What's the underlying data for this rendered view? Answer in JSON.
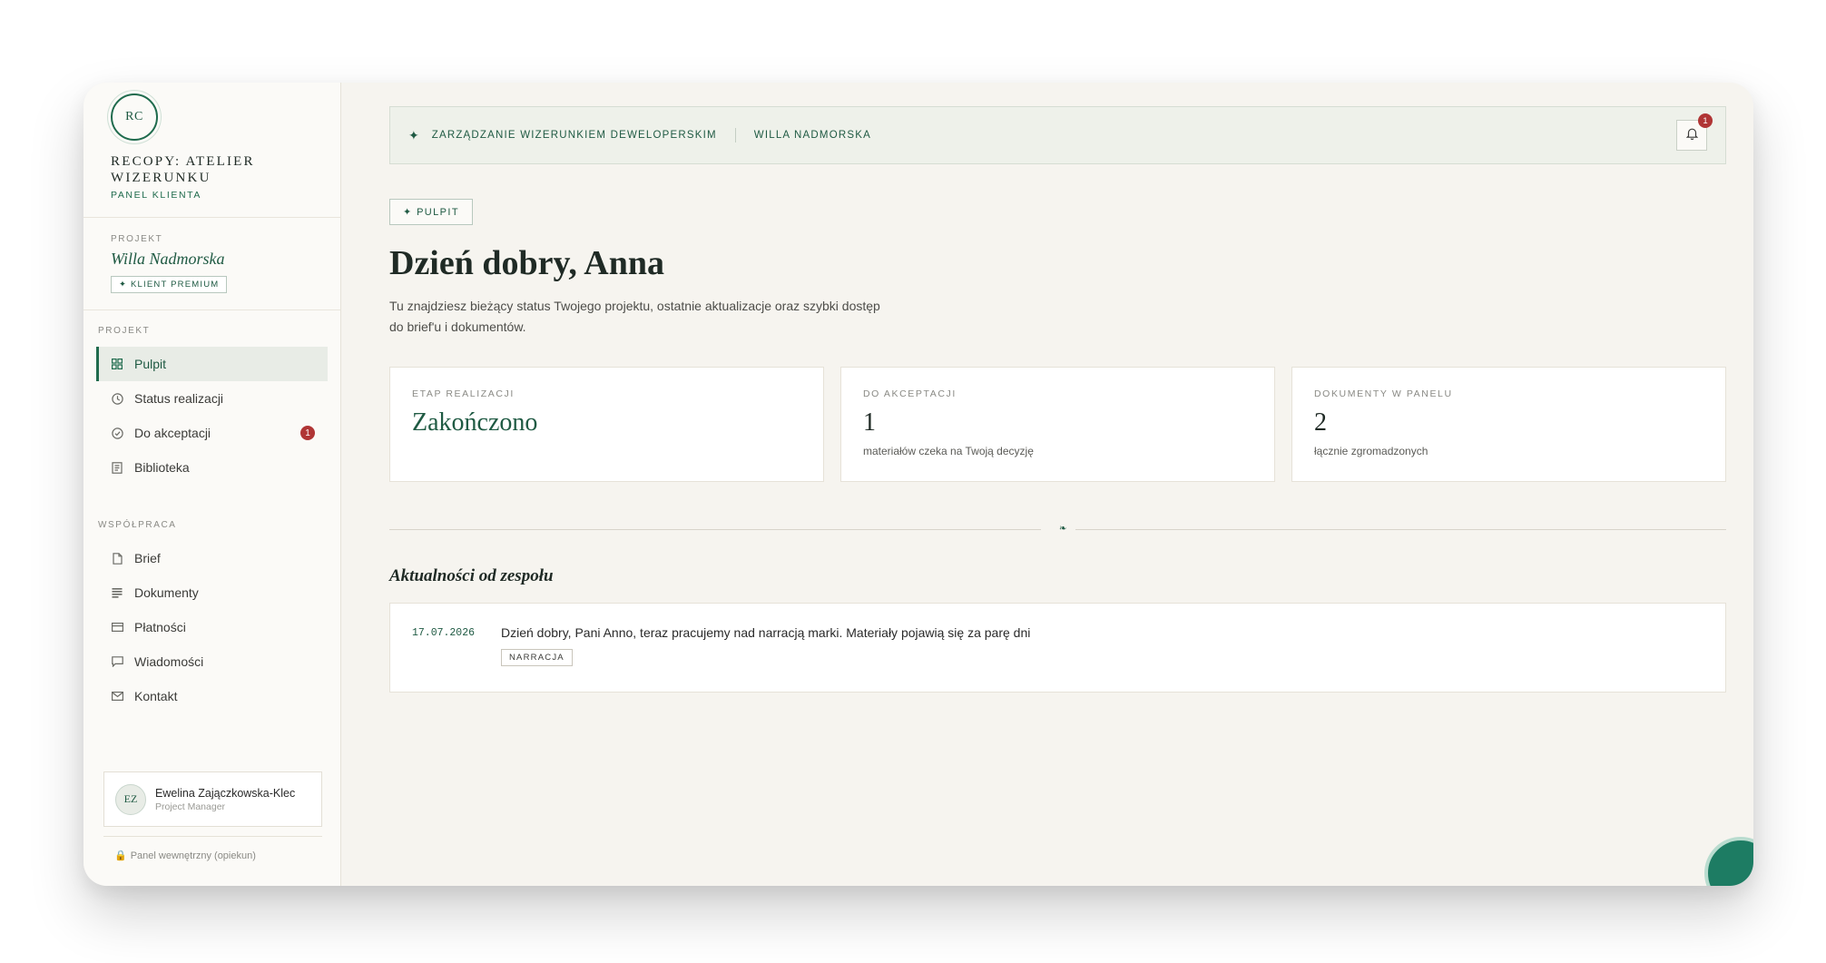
{
  "brand": {
    "logo_initials": "RC",
    "name": "RECOPY: ATELIER WIZERUNKU",
    "subtitle": "PANEL KLIENTA"
  },
  "project": {
    "label": "PROJEKT",
    "name": "Willa Nadmorska",
    "badge": "✦ KLIENT PREMIUM"
  },
  "nav": {
    "section_project": "PROJEKT",
    "section_collab": "WSPÓŁPRACA",
    "items": [
      {
        "label": "Pulpit",
        "icon": "grid-icon",
        "active": true
      },
      {
        "label": "Status realizacji",
        "icon": "clock-icon"
      },
      {
        "label": "Do akceptacji",
        "icon": "check-circle-icon",
        "badge": "1"
      },
      {
        "label": "Biblioteka",
        "icon": "book-icon"
      },
      {
        "label": "Brief",
        "icon": "file-icon"
      },
      {
        "label": "Dokumenty",
        "icon": "documents-icon"
      },
      {
        "label": "Płatności",
        "icon": "card-icon"
      },
      {
        "label": "Wiadomości",
        "icon": "message-icon"
      },
      {
        "label": "Kontakt",
        "icon": "mail-icon"
      }
    ]
  },
  "user": {
    "initials": "EZ",
    "name": "Ewelina Zajączkowska-Klec",
    "role": "Project Manager"
  },
  "internal_link": "Panel wewnętrzny (opiekun)",
  "topbar": {
    "crumb_1": "ZARZĄDZANIE WIZERUNKIEM DEWELOPERSKIM",
    "crumb_2": "WILLA NADMORSKA",
    "notifications": "1"
  },
  "page": {
    "tag": "✦ PULPIT",
    "greeting": "Dzień dobry, Anna",
    "intro": "Tu znajdziesz bieżący status Twojego projektu, ostatnie aktualizacje oraz szybki dostęp do brief'u i dokumentów."
  },
  "cards": [
    {
      "label": "ETAP REALIZACJI",
      "value": "Zakończono",
      "desc": ""
    },
    {
      "label": "DO AKCEPTACJI",
      "value": "1",
      "desc": "materiałów czeka na Twoją decyzję"
    },
    {
      "label": "DOKUMENTY W PANELU",
      "value": "2",
      "desc": "łącznie zgromadzonych"
    }
  ],
  "news": {
    "title": "Aktualności od zespołu",
    "items": [
      {
        "date": "17.07.2026",
        "text": "Dzień dobry, Pani Anno, teraz pracujemy nad narracją marki. Materiały pojawią się za parę dni",
        "tag": "NARRACJA"
      }
    ]
  },
  "colors": {
    "accent": "#1f5a43",
    "badge": "#b03535",
    "fab": "#1d7c63"
  }
}
